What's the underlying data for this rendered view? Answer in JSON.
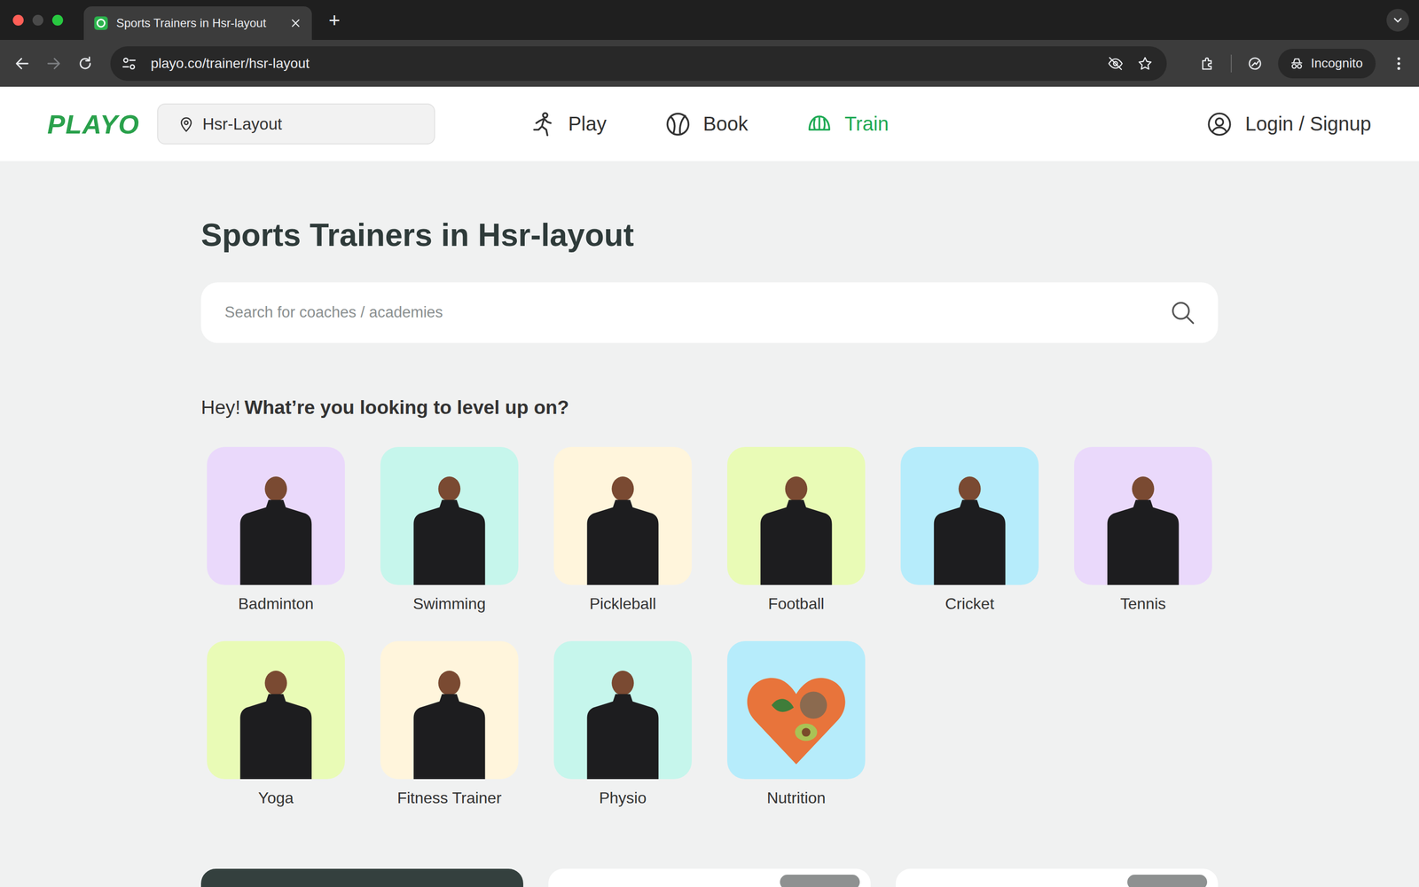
{
  "browser": {
    "tab_title": "Sports Trainers in Hsr-layout",
    "new_tab": "+",
    "url": "playo.co/trainer/hsr-layout",
    "profile": "Incognito"
  },
  "header": {
    "logo": "PLAYO",
    "location": "Hsr-Layout",
    "nav": [
      {
        "label": "Play",
        "selected": false
      },
      {
        "label": "Book",
        "selected": false
      },
      {
        "label": "Train",
        "selected": true
      }
    ],
    "login": "Login / Signup"
  },
  "page": {
    "title": "Sports Trainers in Hsr-layout",
    "search": {
      "placeholder": "Search for coaches / academies"
    },
    "prompt": {
      "lead": "Hey!",
      "bold": "What’re you looking to level up on?"
    }
  },
  "categories": [
    {
      "name": "Badminton",
      "color": "#ead9fb",
      "kind": "person"
    },
    {
      "name": "Swimming",
      "color": "#c6f6ec",
      "kind": "person"
    },
    {
      "name": "Pickleball",
      "color": "#fff5dc",
      "kind": "person"
    },
    {
      "name": "Football",
      "color": "#e9fbb6",
      "kind": "person"
    },
    {
      "name": "Cricket",
      "color": "#b6ecfb",
      "kind": "person"
    },
    {
      "name": "Tennis",
      "color": "#ead9fb",
      "kind": "person"
    },
    {
      "name": "Yoga",
      "color": "#e9fbb6",
      "kind": "person"
    },
    {
      "name": "Fitness Trainer",
      "color": "#fff5dc",
      "kind": "person"
    },
    {
      "name": "Physio",
      "color": "#c6f6ec",
      "kind": "person"
    },
    {
      "name": "Nutrition",
      "color": "#b6ecfb",
      "kind": "food"
    }
  ],
  "cards": [
    {
      "kind": "image"
    },
    {
      "kind": "plain"
    },
    {
      "kind": "plain"
    }
  ]
}
